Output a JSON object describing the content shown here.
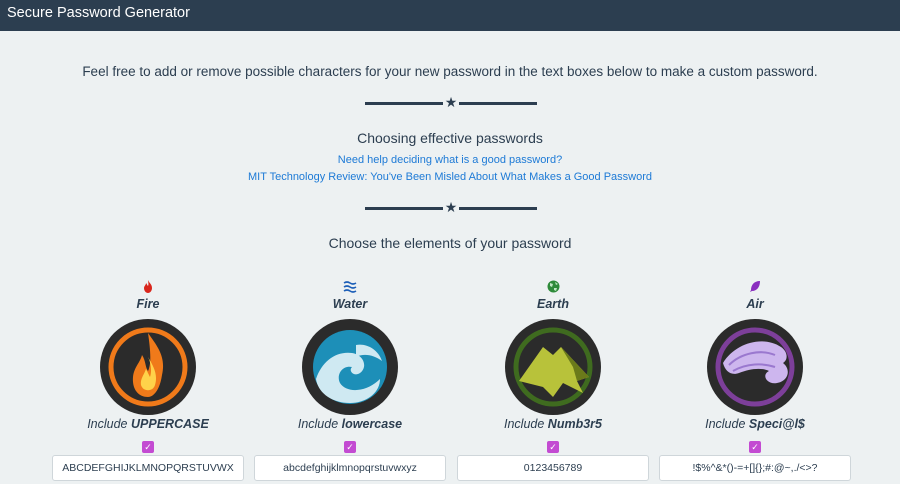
{
  "app": {
    "title": "Secure Password Generator"
  },
  "intro": "Feel free to add or remove possible characters for your new password in the text boxes below to make a custom password.",
  "choosing": {
    "heading": "Choosing effective passwords",
    "links": [
      "Need help deciding what is a good password?",
      "MIT Technology Review: You've Been Misled About What Makes a Good Password"
    ]
  },
  "elements_heading": "Choose the elements of your password",
  "elements": [
    {
      "name": "Fire",
      "icon": "fire-icon",
      "include_prefix": "Include",
      "include_label": "UPPERCASE",
      "checked": true,
      "chars": "ABCDEFGHIJKLMNOPQRSTUVWX",
      "color": "#f07a1a"
    },
    {
      "name": "Water",
      "icon": "water-icon",
      "include_prefix": "Include",
      "include_label": "lowercase",
      "checked": true,
      "chars": "abcdefghijklmnopqrstuvwxyz",
      "color": "#1d8fb8"
    },
    {
      "name": "Earth",
      "icon": "globe-icon",
      "include_prefix": "Include",
      "include_label": "Numb3r5",
      "checked": true,
      "chars": "0123456789",
      "color": "#4a7a26"
    },
    {
      "name": "Air",
      "icon": "feather-icon",
      "include_prefix": "Include",
      "include_label": "Speci@l$",
      "checked": true,
      "chars": "!$%^&*()-=+[]{};#:@~,./<>?",
      "color": "#7d3f9a"
    }
  ],
  "colors": {
    "navbar": "#2c3e50",
    "background": "#edf1f2",
    "link": "#1d7ad6",
    "checkbox": "#c34bd2"
  }
}
